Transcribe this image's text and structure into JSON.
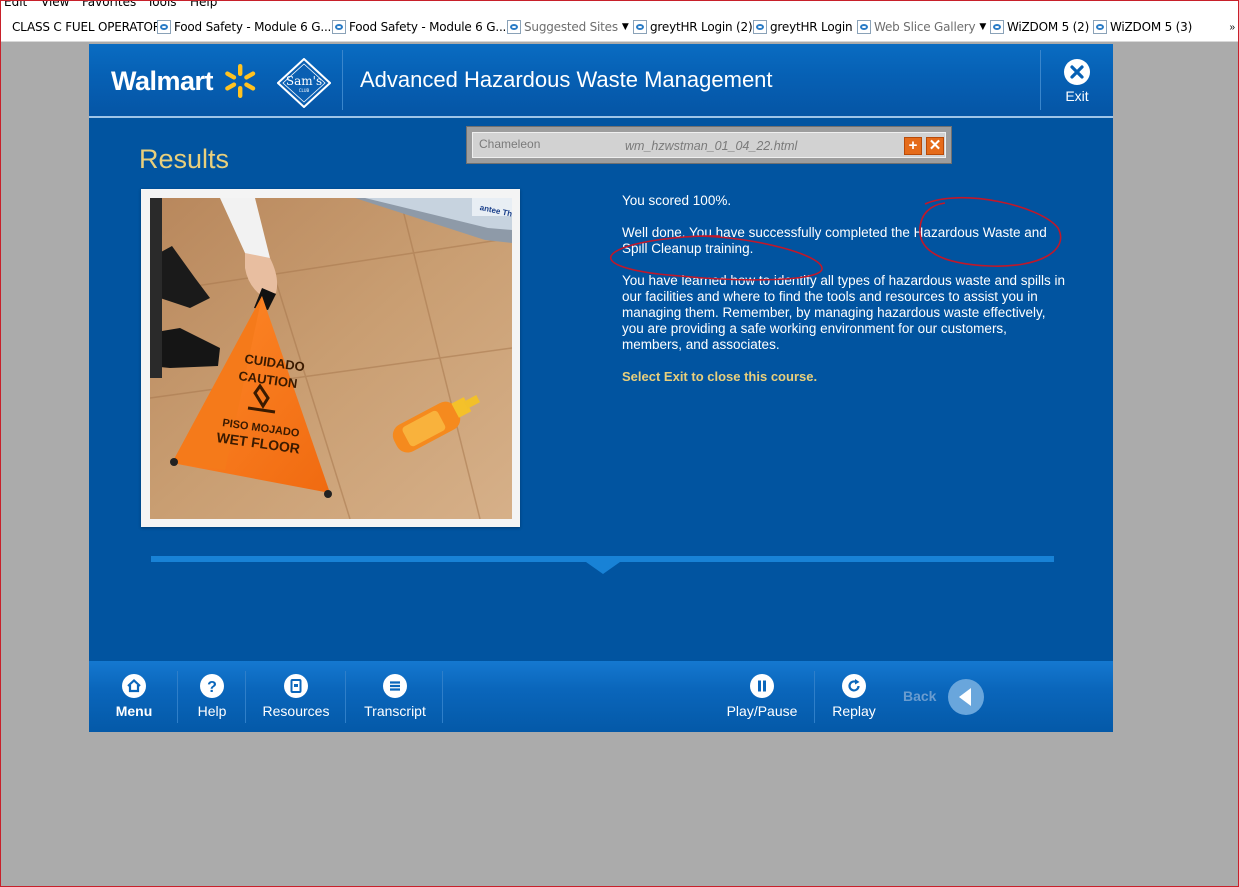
{
  "menubar": {
    "items": [
      "Edit",
      "View",
      "Favorites",
      "Tools",
      "Help"
    ]
  },
  "favorites": [
    {
      "label": "CLASS C FUEL OPERATOR",
      "icon": "page-icon"
    },
    {
      "label": "Food Safety - Module 6 G...",
      "icon": "ie-page-icon"
    },
    {
      "label": "Food Safety - Module 6 G...",
      "icon": "ie-page-icon"
    },
    {
      "label": "Suggested Sites",
      "icon": "ie-page-icon"
    },
    {
      "label": "greytHR Login (2)",
      "icon": "ie-page-icon"
    },
    {
      "label": "greytHR Login",
      "icon": "ie-page-icon"
    },
    {
      "label": "Web Slice Gallery",
      "icon": "ie-page-icon"
    },
    {
      "label": "WiZDOM 5 (2)",
      "icon": "ie-page-icon"
    },
    {
      "label": "WiZDOM 5 (3)",
      "icon": "ie-page-icon"
    }
  ],
  "course": {
    "brand": "Walmart",
    "sams_top": "Sam's",
    "sams_bottom": "CLUB",
    "title": "Advanced Hazardous Waste Management",
    "exit_label": "Exit"
  },
  "chameleon": {
    "logo": "Chameleon",
    "file": "wm_hzwstman_01_04_22.html",
    "plus": "+",
    "close": "✕"
  },
  "results": {
    "heading": "Results",
    "score": "You scored 100%.",
    "well_done": "Well done.  You have successfully completed the Hazardous Waste and Spill Cleanup training.",
    "learned": "You have learned how to identify all types of hazardous waste and spills in our facilities and where to find the tools and resources to assist you in managing them.  Remember, by managing hazardous waste effectively, you are providing a safe working environment for our customers, members, and associates.",
    "cta": "Select Exit to close this course."
  },
  "photo": {
    "sign_line1": "CUIDADO",
    "sign_line2": "CAUTION",
    "sign_line3": "PISO MOJADO",
    "sign_line4": "WET FLOOR",
    "shelf_text": "antee Th"
  },
  "footer": {
    "menu": "Menu",
    "help": "Help",
    "resources": "Resources",
    "transcript": "Transcript",
    "play_pause": "Play/Pause",
    "replay": "Replay",
    "back": "Back"
  },
  "colors": {
    "course_bg": "#0154a0",
    "accent_gold": "#e8cf7c",
    "chameleon_button": "#e56b1a",
    "annotation_red": "#c0182a"
  }
}
